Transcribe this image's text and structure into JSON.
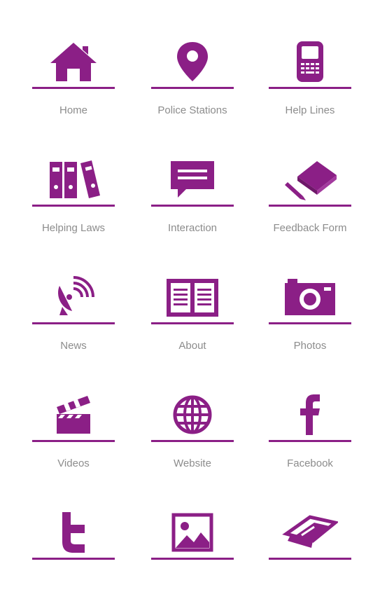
{
  "theme": {
    "accent": "#8b1f86",
    "label_color": "#8c8c8c",
    "background": "#ffffff"
  },
  "menu": {
    "items": [
      {
        "label": "Home",
        "icon": "home-icon"
      },
      {
        "label": "Police Stations",
        "icon": "map-pin-icon"
      },
      {
        "label": "Help Lines",
        "icon": "phone-icon"
      },
      {
        "label": "Helping Laws",
        "icon": "binders-icon"
      },
      {
        "label": "Interaction",
        "icon": "chat-bubble-icon"
      },
      {
        "label": "Feedback Form",
        "icon": "book-pen-icon"
      },
      {
        "label": "News",
        "icon": "satellite-dish-icon"
      },
      {
        "label": "About",
        "icon": "open-book-icon"
      },
      {
        "label": "Photos",
        "icon": "camera-icon"
      },
      {
        "label": "Videos",
        "icon": "clapperboard-icon"
      },
      {
        "label": "Website",
        "icon": "globe-icon"
      },
      {
        "label": "Facebook",
        "icon": "facebook-icon"
      },
      {
        "label": "",
        "icon": "twitter-icon"
      },
      {
        "label": "",
        "icon": "image-icon"
      },
      {
        "label": "",
        "icon": "tickets-icon"
      }
    ]
  }
}
